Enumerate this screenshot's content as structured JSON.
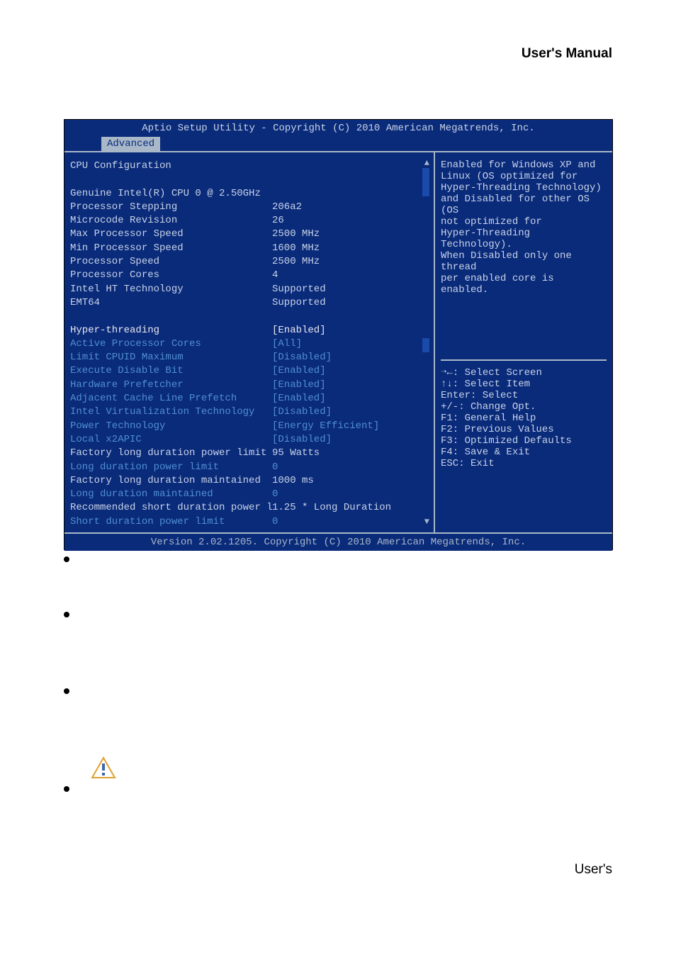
{
  "header": {
    "title": "User's  Manual"
  },
  "bios": {
    "topbar": "Aptio Setup Utility - Copyright (C) 2010 American Megatrends, Inc.",
    "tab": "Advanced",
    "section_title": "CPU Configuration",
    "info": [
      {
        "label": "Genuine Intel(R) CPU 0 @ 2.50GHz",
        "value": ""
      },
      {
        "label": "Processor Stepping",
        "value": "206a2"
      },
      {
        "label": "Microcode Revision",
        "value": "26"
      },
      {
        "label": "Max Processor Speed",
        "value": "2500 MHz"
      },
      {
        "label": "Min Processor Speed",
        "value": "1600 MHz"
      },
      {
        "label": "Processor Speed",
        "value": "2500 MHz"
      },
      {
        "label": "Processor Cores",
        "value": "4"
      },
      {
        "label": "Intel HT Technology",
        "value": "Supported"
      },
      {
        "label": "EMT64",
        "value": "Supported"
      }
    ],
    "selected": {
      "label": "Hyper-threading",
      "value": "[Enabled]"
    },
    "settings": [
      {
        "label": "Active Processor Cores",
        "value": "[All]"
      },
      {
        "label": "Limit CPUID Maximum",
        "value": "[Disabled]"
      },
      {
        "label": "Execute Disable Bit",
        "value": "[Enabled]"
      },
      {
        "label": "Hardware Prefetcher",
        "value": "[Enabled]"
      },
      {
        "label": "Adjacent Cache Line Prefetch",
        "value": "[Enabled]"
      },
      {
        "label": "Intel Virtualization Technology",
        "value": "[Disabled]"
      },
      {
        "label": "Power Technology",
        "value": "[Energy Efficient]"
      },
      {
        "label": "Local x2APIC",
        "value": "[Disabled]"
      },
      {
        "label": "Factory long duration power limit",
        "value": "95 Watts"
      },
      {
        "label": "Long duration power limit",
        "value": "0"
      },
      {
        "label": "Factory long duration maintained",
        "value": "1000 ms"
      },
      {
        "label": "Long duration maintained",
        "value": "0"
      },
      {
        "label": "Recommended short duration power l",
        "value": "1.25 * Long Duration"
      },
      {
        "label": "Short duration power limit",
        "value": "0"
      }
    ],
    "help": [
      "Enabled for Windows XP and",
      "Linux (OS optimized for",
      "Hyper-Threading Technology)",
      "and Disabled for other OS (OS",
      "not optimized for",
      "Hyper-Threading Technology).",
      "When Disabled only one thread",
      "per enabled core is enabled."
    ],
    "keys": [
      "➝←: Select Screen",
      "↑↓: Select Item",
      "Enter: Select",
      "+/-: Change Opt.",
      "F1: General Help",
      "F2: Previous Values",
      "F3: Optimized Defaults",
      "F4: Save & Exit",
      "ESC: Exit"
    ],
    "footer": "Version 2.02.1205. Copyright (C) 2010 American Megatrends, Inc."
  },
  "footer": {
    "text": "User's"
  }
}
